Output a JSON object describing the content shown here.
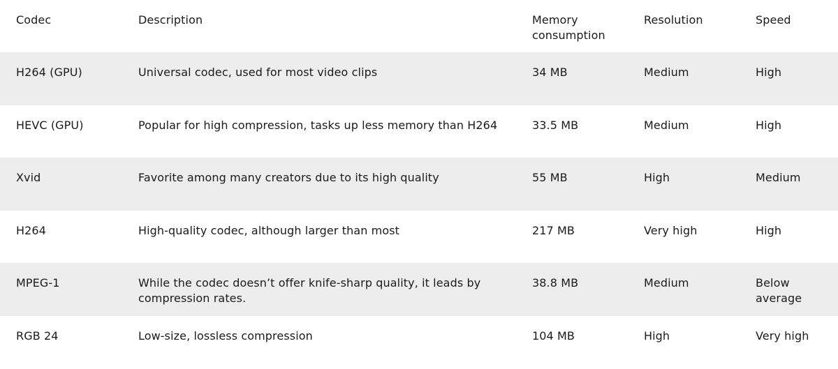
{
  "table": {
    "headers": [
      "Codec",
      "Description",
      "Memory consumption",
      "Resolution",
      "Speed"
    ],
    "rows": [
      [
        "H264 (GPU)",
        "Universal codec, used for most video clips",
        "34 MB",
        "Medium",
        "High"
      ],
      [
        "HEVC (GPU)",
        "Popular for high compression, tasks up less memory than H264",
        "33.5 MB",
        "Medium",
        "High"
      ],
      [
        "Xvid",
        "Favorite among many creators due to its high quality",
        "55 MB",
        "High",
        "Medium"
      ],
      [
        "H264",
        "High-quality codec, although larger than most",
        "217 MB",
        "Very high",
        "High"
      ],
      [
        "MPEG-1",
        "While the codec doesn’t offer knife-sharp quality, it leads by compression rates.",
        "38.8 MB",
        "Medium",
        "Below average"
      ],
      [
        "RGB 24",
        "Low-size, lossless compression",
        "104 MB",
        "High",
        "Very high"
      ]
    ]
  },
  "colors": {
    "stripe": "#ededed",
    "text": "#1a1a1a"
  }
}
